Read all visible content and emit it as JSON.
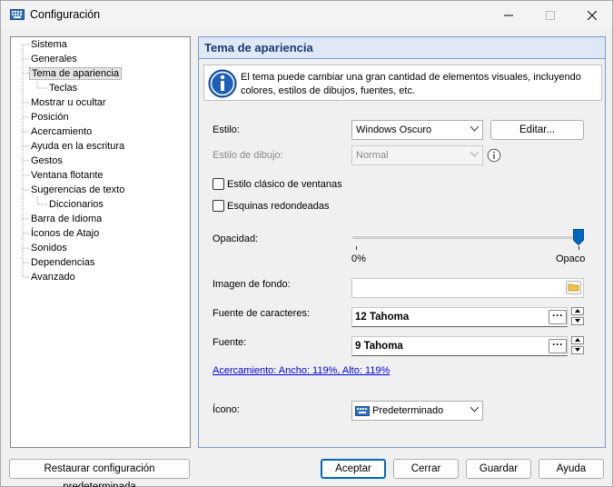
{
  "window": {
    "title": "Configuración"
  },
  "tree": {
    "items": [
      {
        "label": "Sistema",
        "level": 0
      },
      {
        "label": "Generales",
        "level": 0
      },
      {
        "label": "Tema de apariencia",
        "level": 0,
        "selected": true
      },
      {
        "label": "Teclas",
        "level": 1
      },
      {
        "label": "Mostrar u ocultar",
        "level": 0
      },
      {
        "label": "Posición",
        "level": 0
      },
      {
        "label": "Acercamiento",
        "level": 0
      },
      {
        "label": "Ayuda en la escritura",
        "level": 0
      },
      {
        "label": "Gestos",
        "level": 0
      },
      {
        "label": "Ventana flotante",
        "level": 0
      },
      {
        "label": "Sugerencias de texto",
        "level": 0
      },
      {
        "label": "Diccionarios",
        "level": 1
      },
      {
        "label": "Barra de Idioma",
        "level": 0
      },
      {
        "label": "Íconos de Atajo",
        "level": 0
      },
      {
        "label": "Sonidos",
        "level": 0
      },
      {
        "label": "Dependencias",
        "level": 0
      },
      {
        "label": "Avanzado",
        "level": 0
      }
    ]
  },
  "panel": {
    "title": "Tema de apariencia",
    "info": "El tema puede cambiar una gran cantidad de elementos visuales, incluyendo colores, estilos de dibujos, fuentes, etc.",
    "style_label": "Estilo:",
    "style_value": "Windows Oscuro",
    "edit_label": "Editar...",
    "draw_style_label": "Estilo de dibujo:",
    "draw_style_value": "Normal",
    "classic_windows_label": "Estilo clásico de ventanas",
    "rounded_corners_label": "Esquinas redondeadas",
    "opacity_label": "Opacidad:",
    "opacity_min_label": "0%",
    "opacity_max_label": "Opaco",
    "opacity_value": 1.0,
    "background_label": "Imagen de fondo:",
    "background_value": "",
    "char_font_label": "Fuente de caracteres:",
    "char_font_value": "12 Tahoma",
    "font_label": "Fuente:",
    "font_value": "9 Tahoma",
    "zoom_link": "Acercamiento: Ancho: 119%, Alto: 119%",
    "icon_label": "Ícono:",
    "icon_value": "Predeterminado"
  },
  "footer": {
    "restore_label": "Restaurar configuración predeterminada",
    "accept_label": "Aceptar",
    "cancel_label": "Cerrar",
    "save_label": "Guardar",
    "help_label": "Ayuda"
  },
  "colors": {
    "accent": "#0067c0",
    "header_bg": "#dfe8f6",
    "header_text": "#1a3a6e",
    "link": "#0000ee"
  }
}
